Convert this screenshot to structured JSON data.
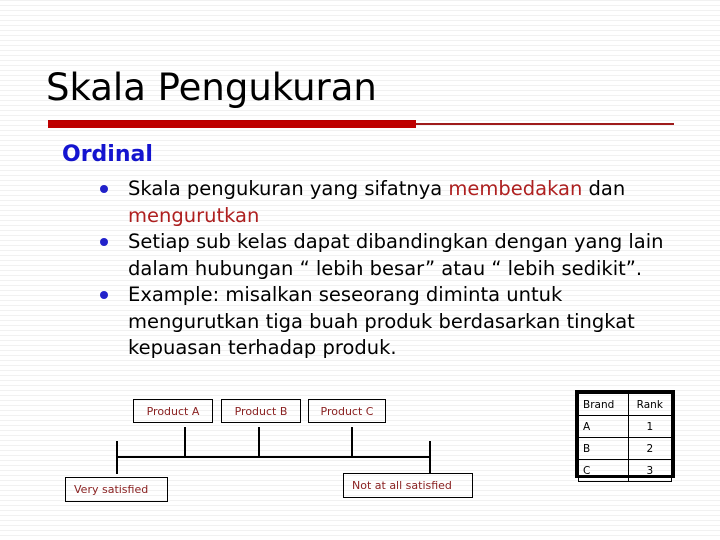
{
  "slide": {
    "title": "Skala Pengukuran",
    "section_heading": "Ordinal",
    "accent_color": "#c00000",
    "heading_color": "#1414d2",
    "highlight_color": "#b02020",
    "bullets": [
      {
        "segments": [
          {
            "text": "Skala pengukuran yang sifatnya ",
            "highlight": false
          },
          {
            "text": "membedakan",
            "highlight": true
          },
          {
            "text": " dan ",
            "highlight": false
          },
          {
            "text": "mengurutkan",
            "highlight": true
          }
        ]
      },
      {
        "segments": [
          {
            "text": "Setiap sub kelas dapat dibandingkan dengan yang lain dalam hubungan “ lebih besar” atau “ lebih sedikit”.",
            "highlight": false
          }
        ]
      },
      {
        "segments": [
          {
            "text": "Example: misalkan seseorang diminta untuk mengurutkan tiga buah produk berdasarkan tingkat kepuasan terhadap produk.",
            "highlight": false
          }
        ]
      }
    ]
  },
  "diagram": {
    "product_boxes": [
      {
        "label": "Product A"
      },
      {
        "label": "Product B"
      },
      {
        "label": "Product C"
      }
    ],
    "anchor_left": "Very satisfied",
    "anchor_right": "Not at all  satisfied"
  },
  "rank_table": {
    "headers": [
      "Brand",
      "Rank"
    ],
    "rows": [
      {
        "brand": "A",
        "rank": "1"
      },
      {
        "brand": "B",
        "rank": "2"
      },
      {
        "brand": "C",
        "rank": "3"
      }
    ]
  }
}
